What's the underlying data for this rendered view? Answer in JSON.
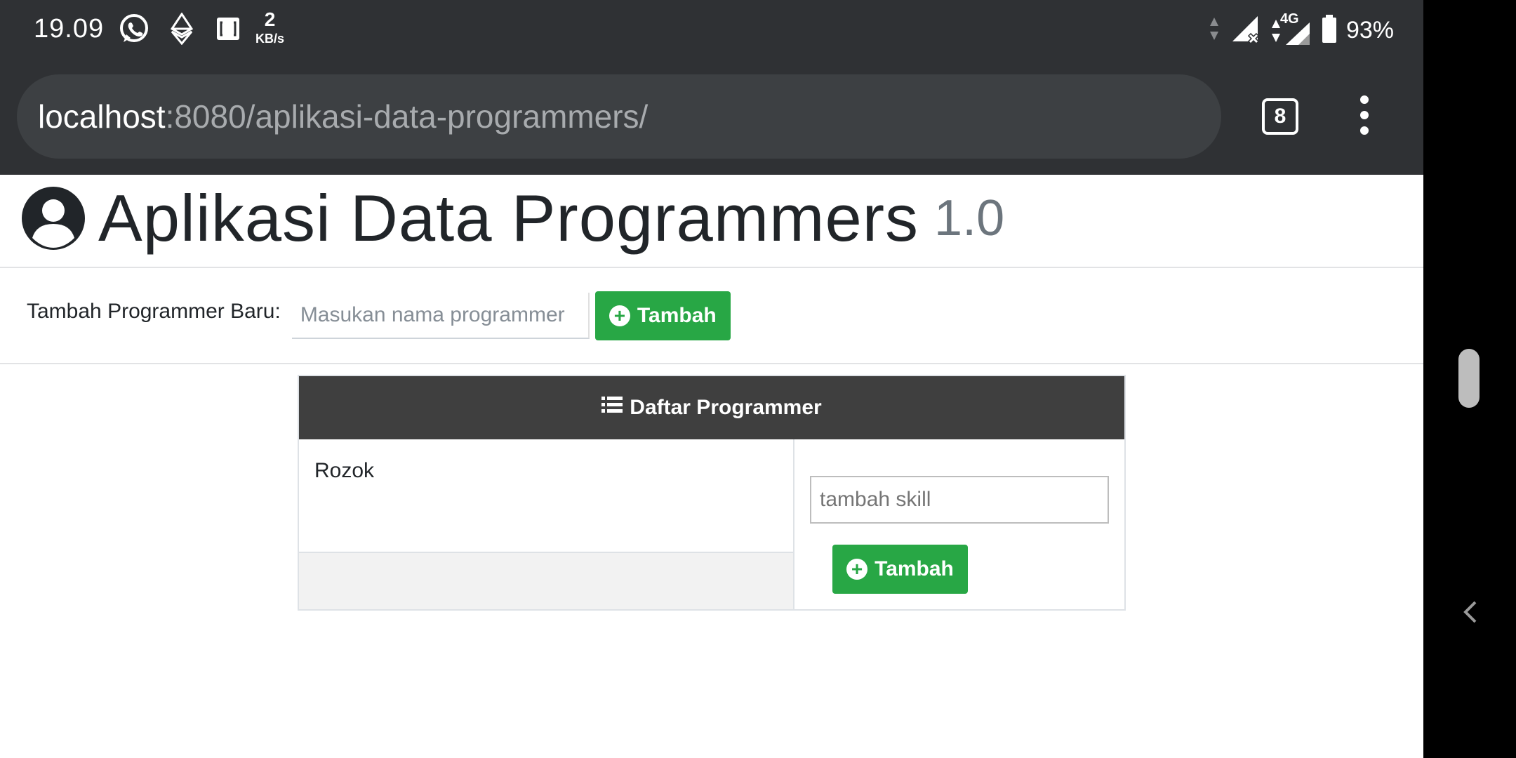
{
  "status_bar": {
    "time": "19.09",
    "speed_value": "2",
    "speed_unit": "KB/s",
    "network": "4G",
    "battery": "93%",
    "icons": [
      "whatsapp-icon",
      "ethereum-icon",
      "screenshot-icon",
      "data-arrows-icon",
      "signal-x-icon",
      "signal-4g-icon",
      "battery-icon"
    ]
  },
  "browser": {
    "url_host": "localhost",
    "url_path": ":8080/aplikasi-data-programmers/",
    "tab_count": "8",
    "menu_icon": "more-vert-icon"
  },
  "header": {
    "title": "Aplikasi Data Programmers",
    "version": "1.0",
    "icon": "user-circle-icon"
  },
  "add_form": {
    "label": "Tambah Programmer Baru:",
    "placeholder": "Masukan nama programmer",
    "button_label": "Tambah"
  },
  "list": {
    "heading": "Daftar Programmer",
    "heading_icon": "list-icon",
    "programmers": [
      {
        "name": "Rozok",
        "skill_placeholder": "tambah skill",
        "skill_button_label": "Tambah"
      }
    ]
  },
  "colors": {
    "success": "#28a745",
    "dark_header": "#3f3f3f",
    "chrome": "#2f3134",
    "muted": "#6c757d"
  }
}
